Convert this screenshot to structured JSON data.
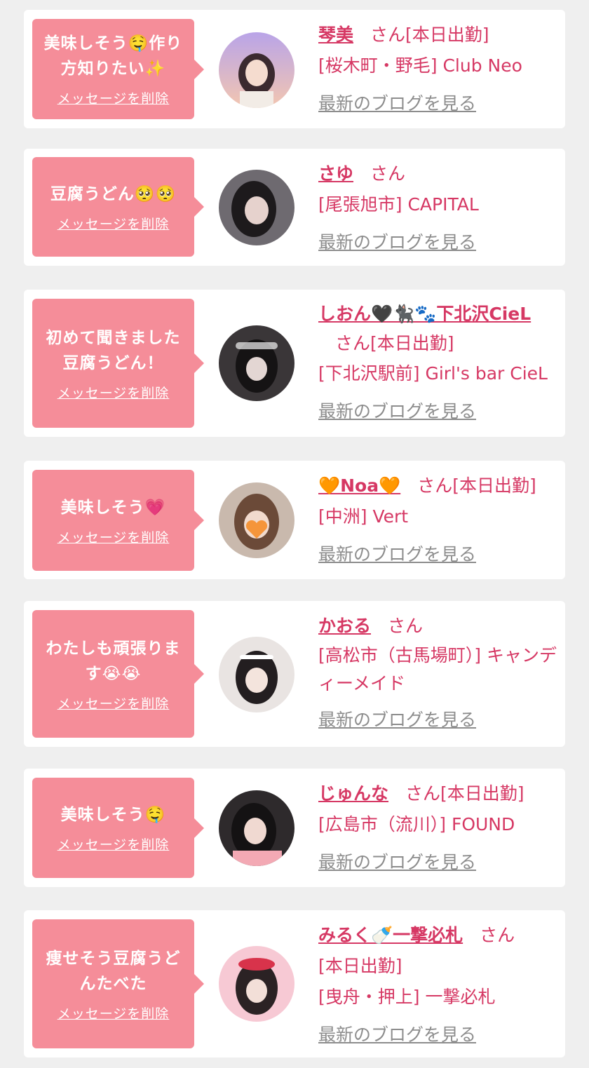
{
  "colors": {
    "bubble": "#f58d99",
    "accent": "#d63864",
    "link_gray": "#8d8d8d",
    "background": "#efefef"
  },
  "common": {
    "delete_label": "メッセージを削除",
    "blog_label": "最新のブログを見る",
    "honorific": "さん"
  },
  "cards": [
    {
      "message": "美味しそう🤤作り方知りたい✨",
      "name": "琴美",
      "shift": "[本日出勤]",
      "location": "[桜木町・野毛] Club Neo",
      "avatar_hint": "purple-sunset-portrait"
    },
    {
      "message": "豆腐うどん🥺🥺",
      "name": "さゆ",
      "shift": "",
      "location": "[尾張旭市] CAPITAL",
      "avatar_hint": "dark-portrait"
    },
    {
      "message": "初めて聞きました豆腐うどん！",
      "name": "しおん🖤🐈‍⬛🐾下北沢CieL",
      "shift": "[本日出勤]",
      "location": "[下北沢駅前] Girl's bar CieL",
      "avatar_hint": "maid-dark"
    },
    {
      "message": "美味しそう💗",
      "name": "🧡Noa🧡",
      "shift": "[本日出勤]",
      "location": "[中洲] Vert",
      "avatar_hint": "heart-face"
    },
    {
      "message": "わたしも頑張ります😭😭",
      "name": "かおる",
      "shift": "",
      "location": "[高松市（古馬場町）] キャンディーメイド",
      "avatar_hint": "maid-light"
    },
    {
      "message": "美味しそう🤤",
      "name": "じゅんな",
      "shift": "[本日出勤]",
      "location": "[広島市（流川）] FOUND",
      "avatar_hint": "dark-hair-pink"
    },
    {
      "message": "痩せそう豆腐うどんたべた",
      "name": "みるく🍼一撃必札",
      "shift": "[本日出勤]",
      "location": "[曳舟・押上] 一撃必札",
      "avatar_hint": "pink-bow"
    }
  ]
}
